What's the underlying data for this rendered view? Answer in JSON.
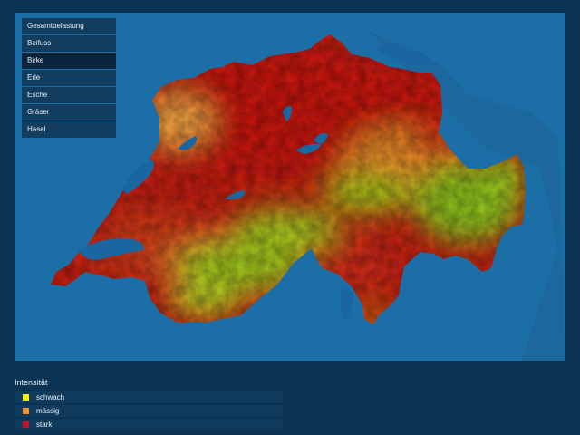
{
  "menu": {
    "items": [
      {
        "label": "Gesamtbelastung",
        "active": false
      },
      {
        "label": "Beifuss",
        "active": false
      },
      {
        "label": "Birke",
        "active": true
      },
      {
        "label": "Erle",
        "active": false
      },
      {
        "label": "Esche",
        "active": false
      },
      {
        "label": "Gräser",
        "active": false
      },
      {
        "label": "Hasel",
        "active": false
      }
    ]
  },
  "legend": {
    "title": "Intensität",
    "items": [
      {
        "label": "schwach",
        "color": "#f2f200"
      },
      {
        "label": "mässig",
        "color": "#f0902a"
      },
      {
        "label": "stark",
        "color": "#c4122a"
      }
    ]
  },
  "colors": {
    "background": "#0b3454",
    "sea": "#1b6aa1",
    "high": "#c81a14",
    "medium": "#e8801e",
    "low": "#8fc21a"
  }
}
